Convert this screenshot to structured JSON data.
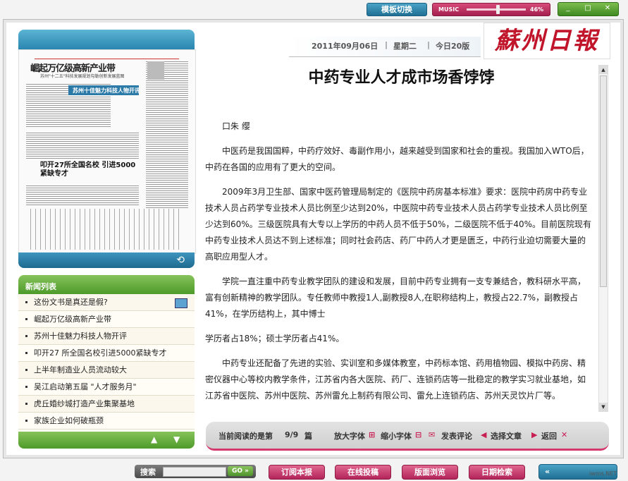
{
  "topbar": {
    "template_switch": "模板切换",
    "music_label": "MUSIC",
    "music_volume": "46%",
    "window_controls": [
      "_",
      "□",
      "✕"
    ]
  },
  "thumbnail": {
    "paper_title": "崛起万亿级高新产业带",
    "paper_sub": "苏州\"十二五\"科技发展规划勾勒创新发展蓝图",
    "headline_2": "苏州十佳魅力科技人物开评",
    "headline_3": "叩开27所全国名校 引进5000紧缺专才",
    "rotate_icon": "⟲"
  },
  "news": {
    "title": "新闻列表",
    "items": [
      "这份文书是真还是假?",
      "崛起万亿级高新产业带",
      "苏州十佳魅力科技人物开评",
      "叩开27 所全国名校引进5000紧缺专才",
      "上半年制造业人员流动较大",
      "吴江启动第五届 \"人才服务月\"",
      "虎丘婚纱城打造产业集聚基地",
      "家族企业如何破瓶颈"
    ],
    "nav_up": "▲",
    "nav_down": "▼"
  },
  "dateline": {
    "date": "2011年09月06日",
    "weekday": "星期二",
    "edition": "今日20版"
  },
  "masthead": "蘇州日報",
  "article": {
    "title": "中药专业人才成市场香饽饽",
    "author": "口朱 缨",
    "paragraphs": [
      "中医药是我国国粹，中药疗效好、毒副作用小，越来越受到国家和社会的重视。我国加入WTO后，中药在各国的应用有了更大的空间。",
      "2009年3月卫生部、国家中医药管理局制定的《医院中药房基本标准》要求：医院中药房中药专业技术人员占药学专业技术人员比例至少达到20%，中医院中药专业技术人员占药学专业技术人员比例至少达到60%。三级医院具有大专以上学历的中药人员不低于50%，二级医院不低于40%。目前医院现有中药专业技术人员达不到上述标准；同时社会药店、药厂中药人才更是匮乏，中药行业迫切需要大量的高职应用型人才。",
      "学院一直注重中药专业教学团队的建设和发展，目前中药专业拥有一支专兼结合，教科研水平高，富有创新精神的教学团队。专任教师中教授1人,副教授8人,在职称结构上，教授占22.7%，副教授占41%，在学历结构上，其中博士",
      "学历者占18%；硕士学历者占41%。",
      "中药专业还配备了先进的实验、实训室和多媒体教室，中药标本馆、药用植物园、模拟中药房、精密仪器中心等校内教学条件，江苏省内各大医院、药厂、连锁药店等一批稳定的教学实习就业基地，如江苏省中医院、苏州中医院、苏州雷允上制药有限公司、雷允上连锁药店、苏州天灵饮片厂等。"
    ]
  },
  "readbar": {
    "current_label": "当前阅读的是第",
    "current_value": "9/9",
    "current_unit": "篇",
    "enlarge": "放大字体",
    "shrink": "缩小字体",
    "comment": "发表评论",
    "select": "选择文章",
    "back": "返回"
  },
  "bottom": {
    "search_label": "搜索",
    "search_go": "GO »",
    "buttons": [
      "订阅本报",
      "在线投稿",
      "版面浏览",
      "日期检索"
    ],
    "back_icon": "«",
    "watermark": "iwms.NET"
  }
}
